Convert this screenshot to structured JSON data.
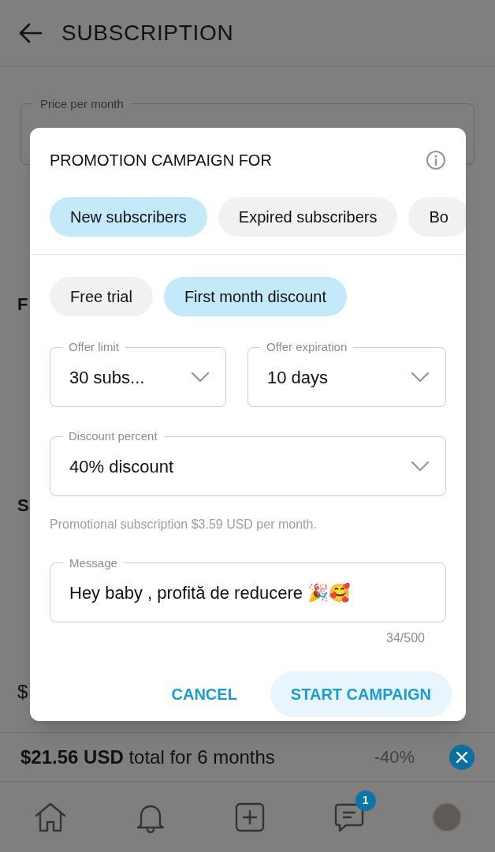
{
  "header": {
    "title": "SUBSCRIPTION"
  },
  "background": {
    "price_label": "Price per month",
    "fragments": [
      "F",
      "S",
      "$"
    ],
    "last_row": {
      "text": "**$21.56 USD** total for 6 months",
      "discount": "-40%"
    }
  },
  "dialog": {
    "title": "PROMOTION CAMPAIGN FOR",
    "audience": [
      {
        "label": "New subscribers",
        "selected": true
      },
      {
        "label": "Expired subscribers",
        "selected": false
      },
      {
        "label": "Bo",
        "selected": false
      }
    ],
    "offer_types": [
      {
        "label": "Free trial",
        "selected": false
      },
      {
        "label": "First month discount",
        "selected": true
      }
    ],
    "offer_limit": {
      "label": "Offer limit",
      "value": "30 subs..."
    },
    "offer_expiration": {
      "label": "Offer expiration",
      "value": "10 days"
    },
    "discount": {
      "label": "Discount percent",
      "value": "40% discount"
    },
    "helper": "Promotional subscription $3.59 USD per month.",
    "message": {
      "label": "Message",
      "value": "Hey baby , profită de reducere 🎉🥰",
      "counter": "34/500"
    },
    "buttons": [
      {
        "label": "CANCEL",
        "kind": "text"
      },
      {
        "label": "START CAMPAIGN",
        "kind": "filled"
      }
    ]
  },
  "nav": [
    {
      "kind": "home"
    },
    {
      "kind": "bell"
    },
    {
      "kind": "add"
    },
    {
      "kind": "chat",
      "badge": "1"
    },
    {
      "kind": "avatar"
    }
  ]
}
